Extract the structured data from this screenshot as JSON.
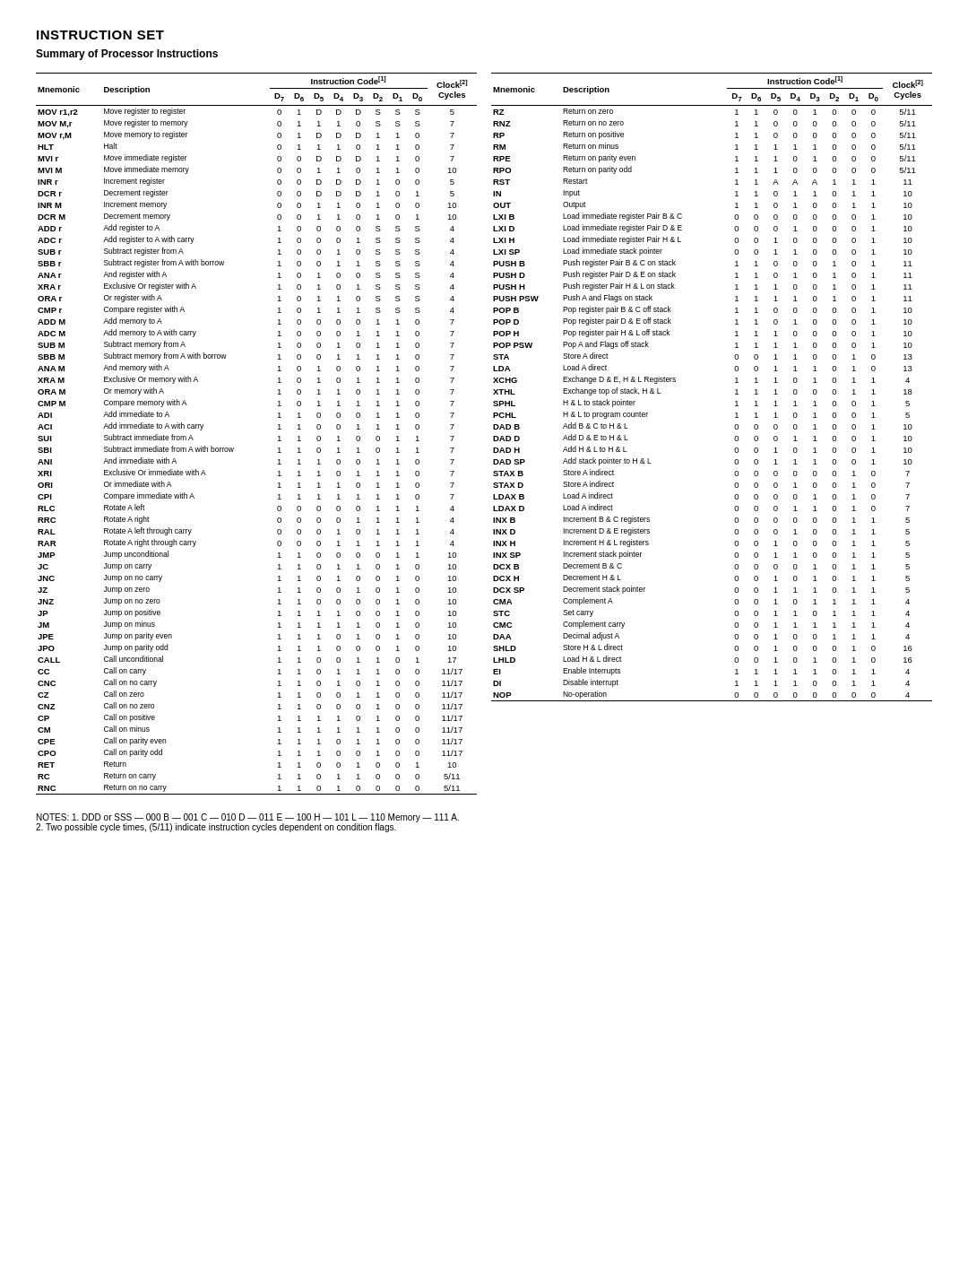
{
  "title": "INSTRUCTION SET",
  "subtitle": "Summary of Processor Instructions",
  "col_headers": {
    "mnemonic": "Mnemonic",
    "description": "Description",
    "d7": "D7",
    "d6": "D6",
    "d5": "D5",
    "d4": "D4",
    "d3": "D3",
    "d2": "D2",
    "d1": "D1",
    "d0": "D0",
    "clock": "Clock",
    "cycles": "Cycles",
    "instruction_code": "Instruction Code",
    "superscript1": "[1]",
    "superscript2": "[2]"
  },
  "left_instructions": [
    [
      "MOV r1,r2",
      "Move register to register",
      "0",
      "1",
      "D",
      "D",
      "D",
      "S",
      "S",
      "S",
      "5"
    ],
    [
      "MOV M,r",
      "Move register to memory",
      "0",
      "1",
      "1",
      "1",
      "0",
      "S",
      "S",
      "S",
      "7"
    ],
    [
      "MOV r,M",
      "Move memory to register",
      "0",
      "1",
      "D",
      "D",
      "D",
      "1",
      "1",
      "0",
      "7"
    ],
    [
      "HLT",
      "Halt",
      "0",
      "1",
      "1",
      "1",
      "0",
      "1",
      "1",
      "0",
      "7"
    ],
    [
      "MVI r",
      "Move immediate register",
      "0",
      "0",
      "D",
      "D",
      "D",
      "1",
      "1",
      "0",
      "7"
    ],
    [
      "MVI M",
      "Move immediate memory",
      "0",
      "0",
      "1",
      "1",
      "0",
      "1",
      "1",
      "0",
      "10"
    ],
    [
      "INR r",
      "Increment register",
      "0",
      "0",
      "D",
      "D",
      "D",
      "1",
      "0",
      "0",
      "5"
    ],
    [
      "DCR r",
      "Decrement register",
      "0",
      "0",
      "D",
      "D",
      "D",
      "1",
      "0",
      "1",
      "5"
    ],
    [
      "INR M",
      "Increment memory",
      "0",
      "0",
      "1",
      "1",
      "0",
      "1",
      "0",
      "0",
      "10"
    ],
    [
      "DCR M",
      "Decrement memory",
      "0",
      "0",
      "1",
      "1",
      "0",
      "1",
      "0",
      "1",
      "10"
    ],
    [
      "ADD r",
      "Add register to A",
      "1",
      "0",
      "0",
      "0",
      "0",
      "S",
      "S",
      "S",
      "4"
    ],
    [
      "ADC r",
      "Add register to A with carry",
      "1",
      "0",
      "0",
      "0",
      "1",
      "S",
      "S",
      "S",
      "4"
    ],
    [
      "SUB r",
      "Subtract register from A",
      "1",
      "0",
      "0",
      "1",
      "0",
      "S",
      "S",
      "S",
      "4"
    ],
    [
      "SBB r",
      "Subtract register from A with borrow",
      "1",
      "0",
      "0",
      "1",
      "1",
      "S",
      "S",
      "S",
      "4"
    ],
    [
      "ANA r",
      "And register with A",
      "1",
      "0",
      "1",
      "0",
      "0",
      "S",
      "S",
      "S",
      "4"
    ],
    [
      "XRA r",
      "Exclusive Or register with A",
      "1",
      "0",
      "1",
      "0",
      "1",
      "S",
      "S",
      "S",
      "4"
    ],
    [
      "ORA r",
      "Or register with A",
      "1",
      "0",
      "1",
      "1",
      "0",
      "S",
      "S",
      "S",
      "4"
    ],
    [
      "CMP r",
      "Compare register with A",
      "1",
      "0",
      "1",
      "1",
      "1",
      "S",
      "S",
      "S",
      "4"
    ],
    [
      "ADD M",
      "Add memory to A",
      "1",
      "0",
      "0",
      "0",
      "0",
      "1",
      "1",
      "0",
      "7"
    ],
    [
      "ADC M",
      "Add memory to A with carry",
      "1",
      "0",
      "0",
      "0",
      "1",
      "1",
      "1",
      "0",
      "7"
    ],
    [
      "SUB M",
      "Subtract memory from A",
      "1",
      "0",
      "0",
      "1",
      "0",
      "1",
      "1",
      "0",
      "7"
    ],
    [
      "SBB M",
      "Subtract memory from A with borrow",
      "1",
      "0",
      "0",
      "1",
      "1",
      "1",
      "1",
      "0",
      "7"
    ],
    [
      "ANA M",
      "And memory with A",
      "1",
      "0",
      "1",
      "0",
      "0",
      "1",
      "1",
      "0",
      "7"
    ],
    [
      "XRA M",
      "Exclusive Or memory with A",
      "1",
      "0",
      "1",
      "0",
      "1",
      "1",
      "1",
      "0",
      "7"
    ],
    [
      "ORA M",
      "Or memory with A",
      "1",
      "0",
      "1",
      "1",
      "0",
      "1",
      "1",
      "0",
      "7"
    ],
    [
      "CMP M",
      "Compare memory with A",
      "1",
      "0",
      "1",
      "1",
      "1",
      "1",
      "1",
      "0",
      "7"
    ],
    [
      "ADI",
      "Add immediate to A",
      "1",
      "1",
      "0",
      "0",
      "0",
      "1",
      "1",
      "0",
      "7"
    ],
    [
      "ACI",
      "Add immediate to A with carry",
      "1",
      "1",
      "0",
      "0",
      "1",
      "1",
      "1",
      "0",
      "7"
    ],
    [
      "SUI",
      "Subtract immediate from A",
      "1",
      "1",
      "0",
      "1",
      "0",
      "0",
      "1",
      "1",
      "7"
    ],
    [
      "SBI",
      "Subtract immediate from A with borrow",
      "1",
      "1",
      "0",
      "1",
      "1",
      "0",
      "1",
      "1",
      "7"
    ],
    [
      "ANI",
      "And immediate with A",
      "1",
      "1",
      "1",
      "0",
      "0",
      "1",
      "1",
      "0",
      "7"
    ],
    [
      "XRI",
      "Exclusive Or immediate with A",
      "1",
      "1",
      "1",
      "0",
      "1",
      "1",
      "1",
      "0",
      "7"
    ],
    [
      "ORI",
      "Or immediate with A",
      "1",
      "1",
      "1",
      "1",
      "0",
      "1",
      "1",
      "0",
      "7"
    ],
    [
      "CPI",
      "Compare immediate with A",
      "1",
      "1",
      "1",
      "1",
      "1",
      "1",
      "1",
      "0",
      "7"
    ],
    [
      "RLC",
      "Rotate A left",
      "0",
      "0",
      "0",
      "0",
      "0",
      "1",
      "1",
      "1",
      "4"
    ],
    [
      "RRC",
      "Rotate A right",
      "0",
      "0",
      "0",
      "0",
      "1",
      "1",
      "1",
      "1",
      "4"
    ],
    [
      "RAL",
      "Rotate A left through carry",
      "0",
      "0",
      "0",
      "1",
      "0",
      "1",
      "1",
      "1",
      "4"
    ],
    [
      "RAR",
      "Rotate A right through carry",
      "0",
      "0",
      "0",
      "1",
      "1",
      "1",
      "1",
      "1",
      "4"
    ],
    [
      "JMP",
      "Jump unconditional",
      "1",
      "1",
      "0",
      "0",
      "0",
      "0",
      "1",
      "1",
      "10"
    ],
    [
      "JC",
      "Jump on carry",
      "1",
      "1",
      "0",
      "1",
      "1",
      "0",
      "1",
      "0",
      "10"
    ],
    [
      "JNC",
      "Jump on no carry",
      "1",
      "1",
      "0",
      "1",
      "0",
      "0",
      "1",
      "0",
      "10"
    ],
    [
      "JZ",
      "Jump on zero",
      "1",
      "1",
      "0",
      "0",
      "1",
      "0",
      "1",
      "0",
      "10"
    ],
    [
      "JNZ",
      "Jump on no zero",
      "1",
      "1",
      "0",
      "0",
      "0",
      "0",
      "1",
      "0",
      "10"
    ],
    [
      "JP",
      "Jump on positive",
      "1",
      "1",
      "1",
      "1",
      "0",
      "0",
      "1",
      "0",
      "10"
    ],
    [
      "JM",
      "Jump on minus",
      "1",
      "1",
      "1",
      "1",
      "1",
      "0",
      "1",
      "0",
      "10"
    ],
    [
      "JPE",
      "Jump on parity even",
      "1",
      "1",
      "1",
      "0",
      "1",
      "0",
      "1",
      "0",
      "10"
    ],
    [
      "JPO",
      "Jump on parity odd",
      "1",
      "1",
      "1",
      "0",
      "0",
      "0",
      "1",
      "0",
      "10"
    ],
    [
      "CALL",
      "Call unconditional",
      "1",
      "1",
      "0",
      "0",
      "1",
      "1",
      "0",
      "1",
      "17"
    ],
    [
      "CC",
      "Call on carry",
      "1",
      "1",
      "0",
      "1",
      "1",
      "1",
      "0",
      "0",
      "11/17"
    ],
    [
      "CNC",
      "Call on no carry",
      "1",
      "1",
      "0",
      "1",
      "0",
      "1",
      "0",
      "0",
      "11/17"
    ],
    [
      "CZ",
      "Call on zero",
      "1",
      "1",
      "0",
      "0",
      "1",
      "1",
      "0",
      "0",
      "11/17"
    ],
    [
      "CNZ",
      "Call on no zero",
      "1",
      "1",
      "0",
      "0",
      "0",
      "1",
      "0",
      "0",
      "11/17"
    ],
    [
      "CP",
      "Call on positive",
      "1",
      "1",
      "1",
      "1",
      "0",
      "1",
      "0",
      "0",
      "11/17"
    ],
    [
      "CM",
      "Call on minus",
      "1",
      "1",
      "1",
      "1",
      "1",
      "1",
      "0",
      "0",
      "11/17"
    ],
    [
      "CPE",
      "Call on parity even",
      "1",
      "1",
      "1",
      "0",
      "1",
      "1",
      "0",
      "0",
      "11/17"
    ],
    [
      "CPO",
      "Call on parity odd",
      "1",
      "1",
      "1",
      "0",
      "0",
      "1",
      "0",
      "0",
      "11/17"
    ],
    [
      "RET",
      "Return",
      "1",
      "1",
      "0",
      "0",
      "1",
      "0",
      "0",
      "1",
      "10"
    ],
    [
      "RC",
      "Return on carry",
      "1",
      "1",
      "0",
      "1",
      "1",
      "0",
      "0",
      "0",
      "5/11"
    ],
    [
      "RNC",
      "Return on no carry",
      "1",
      "1",
      "0",
      "1",
      "0",
      "0",
      "0",
      "0",
      "5/11"
    ]
  ],
  "right_instructions": [
    [
      "RZ",
      "Return on zero",
      "1",
      "1",
      "0",
      "0",
      "1",
      "0",
      "0",
      "0",
      "5/11"
    ],
    [
      "RNZ",
      "Return on no zero",
      "1",
      "1",
      "0",
      "0",
      "0",
      "0",
      "0",
      "0",
      "5/11"
    ],
    [
      "RP",
      "Return on positive",
      "1",
      "1",
      "0",
      "0",
      "0",
      "0",
      "0",
      "0",
      "5/11"
    ],
    [
      "RM",
      "Return on minus",
      "1",
      "1",
      "1",
      "1",
      "1",
      "0",
      "0",
      "0",
      "5/11"
    ],
    [
      "RPE",
      "Return on parity even",
      "1",
      "1",
      "1",
      "0",
      "1",
      "0",
      "0",
      "0",
      "5/11"
    ],
    [
      "RPO",
      "Return on parity odd",
      "1",
      "1",
      "1",
      "0",
      "0",
      "0",
      "0",
      "0",
      "5/11"
    ],
    [
      "RST",
      "Restart",
      "1",
      "1",
      "A",
      "A",
      "A",
      "1",
      "1",
      "1",
      "11"
    ],
    [
      "IN",
      "Input",
      "1",
      "1",
      "0",
      "1",
      "1",
      "0",
      "1",
      "1",
      "10"
    ],
    [
      "OUT",
      "Output",
      "1",
      "1",
      "0",
      "1",
      "0",
      "0",
      "1",
      "1",
      "10"
    ],
    [
      "LXI B",
      "Load immediate register Pair B & C",
      "0",
      "0",
      "0",
      "0",
      "0",
      "0",
      "0",
      "1",
      "10"
    ],
    [
      "LXI D",
      "Load immediate register Pair D & E",
      "0",
      "0",
      "0",
      "1",
      "0",
      "0",
      "0",
      "1",
      "10"
    ],
    [
      "LXI H",
      "Load immediate register Pair H & L",
      "0",
      "0",
      "1",
      "0",
      "0",
      "0",
      "0",
      "1",
      "10"
    ],
    [
      "LXI SP",
      "Load immediate stack pointer",
      "0",
      "0",
      "1",
      "1",
      "0",
      "0",
      "0",
      "1",
      "10"
    ],
    [
      "PUSH B",
      "Push register Pair B & C on stack",
      "1",
      "1",
      "0",
      "0",
      "0",
      "1",
      "0",
      "1",
      "11"
    ],
    [
      "PUSH D",
      "Push register Pair D & E on stack",
      "1",
      "1",
      "0",
      "1",
      "0",
      "1",
      "0",
      "1",
      "11"
    ],
    [
      "PUSH H",
      "Push register Pair H & L on stack",
      "1",
      "1",
      "1",
      "0",
      "0",
      "1",
      "0",
      "1",
      "11"
    ],
    [
      "PUSH PSW",
      "Push A and Flags on stack",
      "1",
      "1",
      "1",
      "1",
      "0",
      "1",
      "0",
      "1",
      "11"
    ],
    [
      "POP B",
      "Pop register pair B & C off stack",
      "1",
      "1",
      "0",
      "0",
      "0",
      "0",
      "0",
      "1",
      "10"
    ],
    [
      "POP D",
      "Pop register pair D & E off stack",
      "1",
      "1",
      "0",
      "1",
      "0",
      "0",
      "0",
      "1",
      "10"
    ],
    [
      "POP H",
      "Pop register pair H & L off stack",
      "1",
      "1",
      "1",
      "0",
      "0",
      "0",
      "0",
      "1",
      "10"
    ],
    [
      "POP PSW",
      "Pop A and Flags off stack",
      "1",
      "1",
      "1",
      "1",
      "0",
      "0",
      "0",
      "1",
      "10"
    ],
    [
      "STA",
      "Store A direct",
      "0",
      "0",
      "1",
      "1",
      "0",
      "0",
      "1",
      "0",
      "13"
    ],
    [
      "LDA",
      "Load A direct",
      "0",
      "0",
      "1",
      "1",
      "1",
      "0",
      "1",
      "0",
      "13"
    ],
    [
      "XCHG",
      "Exchange D & E, H & L Registers",
      "1",
      "1",
      "1",
      "0",
      "1",
      "0",
      "1",
      "1",
      "4"
    ],
    [
      "XTHL",
      "Exchange top of stack, H & L",
      "1",
      "1",
      "1",
      "0",
      "0",
      "0",
      "1",
      "1",
      "18"
    ],
    [
      "SPHL",
      "H & L to stack pointer",
      "1",
      "1",
      "1",
      "1",
      "1",
      "0",
      "0",
      "1",
      "5"
    ],
    [
      "PCHL",
      "H & L to program counter",
      "1",
      "1",
      "1",
      "0",
      "1",
      "0",
      "0",
      "1",
      "5"
    ],
    [
      "DAD B",
      "Add B & C to H & L",
      "0",
      "0",
      "0",
      "0",
      "1",
      "0",
      "0",
      "1",
      "10"
    ],
    [
      "DAD D",
      "Add D & E to H & L",
      "0",
      "0",
      "0",
      "1",
      "1",
      "0",
      "0",
      "1",
      "10"
    ],
    [
      "DAD H",
      "Add H & L to H & L",
      "0",
      "0",
      "1",
      "0",
      "1",
      "0",
      "0",
      "1",
      "10"
    ],
    [
      "DAD SP",
      "Add stack pointer to H & L",
      "0",
      "0",
      "1",
      "1",
      "1",
      "0",
      "0",
      "1",
      "10"
    ],
    [
      "STAX B",
      "Store A indirect",
      "0",
      "0",
      "0",
      "0",
      "0",
      "0",
      "1",
      "0",
      "7"
    ],
    [
      "STAX D",
      "Store A indirect",
      "0",
      "0",
      "0",
      "1",
      "0",
      "0",
      "1",
      "0",
      "7"
    ],
    [
      "LDAX B",
      "Load A indirect",
      "0",
      "0",
      "0",
      "0",
      "1",
      "0",
      "1",
      "0",
      "7"
    ],
    [
      "LDAX D",
      "Load A indirect",
      "0",
      "0",
      "0",
      "1",
      "1",
      "0",
      "1",
      "0",
      "7"
    ],
    [
      "INX B",
      "Increment B & C registers",
      "0",
      "0",
      "0",
      "0",
      "0",
      "0",
      "1",
      "1",
      "5"
    ],
    [
      "INX D",
      "Increment D & E registers",
      "0",
      "0",
      "0",
      "1",
      "0",
      "0",
      "1",
      "1",
      "5"
    ],
    [
      "INX H",
      "Increment H & L registers",
      "0",
      "0",
      "1",
      "0",
      "0",
      "0",
      "1",
      "1",
      "5"
    ],
    [
      "INX SP",
      "Increment stack pointer",
      "0",
      "0",
      "1",
      "1",
      "0",
      "0",
      "1",
      "1",
      "5"
    ],
    [
      "DCX B",
      "Decrement B & C",
      "0",
      "0",
      "0",
      "0",
      "1",
      "0",
      "1",
      "1",
      "5"
    ],
    [
      "DCX H",
      "Decrement H & L",
      "0",
      "0",
      "1",
      "0",
      "1",
      "0",
      "1",
      "1",
      "5"
    ],
    [
      "DCX SP",
      "Decrement stack pointer",
      "0",
      "0",
      "1",
      "1",
      "1",
      "0",
      "1",
      "1",
      "5"
    ],
    [
      "CMA",
      "Complement A",
      "0",
      "0",
      "1",
      "0",
      "1",
      "1",
      "1",
      "1",
      "4"
    ],
    [
      "STC",
      "Set carry",
      "0",
      "0",
      "1",
      "1",
      "0",
      "1",
      "1",
      "1",
      "4"
    ],
    [
      "CMC",
      "Complement carry",
      "0",
      "0",
      "1",
      "1",
      "1",
      "1",
      "1",
      "1",
      "4"
    ],
    [
      "DAA",
      "Decimal adjust A",
      "0",
      "0",
      "1",
      "0",
      "0",
      "1",
      "1",
      "1",
      "4"
    ],
    [
      "SHLD",
      "Store H & L direct",
      "0",
      "0",
      "1",
      "0",
      "0",
      "0",
      "1",
      "0",
      "16"
    ],
    [
      "LHLD",
      "Load H & L direct",
      "0",
      "0",
      "1",
      "0",
      "1",
      "0",
      "1",
      "0",
      "16"
    ],
    [
      "EI",
      "Enable Interrupts",
      "1",
      "1",
      "1",
      "1",
      "1",
      "0",
      "1",
      "1",
      "4"
    ],
    [
      "DI",
      "Disable interrupt",
      "1",
      "1",
      "1",
      "1",
      "0",
      "0",
      "1",
      "1",
      "4"
    ],
    [
      "NOP",
      "No-operation",
      "0",
      "0",
      "0",
      "0",
      "0",
      "0",
      "0",
      "0",
      "4"
    ]
  ],
  "notes": [
    "NOTES:  1.  DDD or SSS — 000 B — 001 C — 010 D — 011 E — 100 H — 101 L — 110 Memory — 111 A.",
    "2.  Two possible cycle times, (5/11) indicate instruction cycles dependent on condition flags."
  ]
}
